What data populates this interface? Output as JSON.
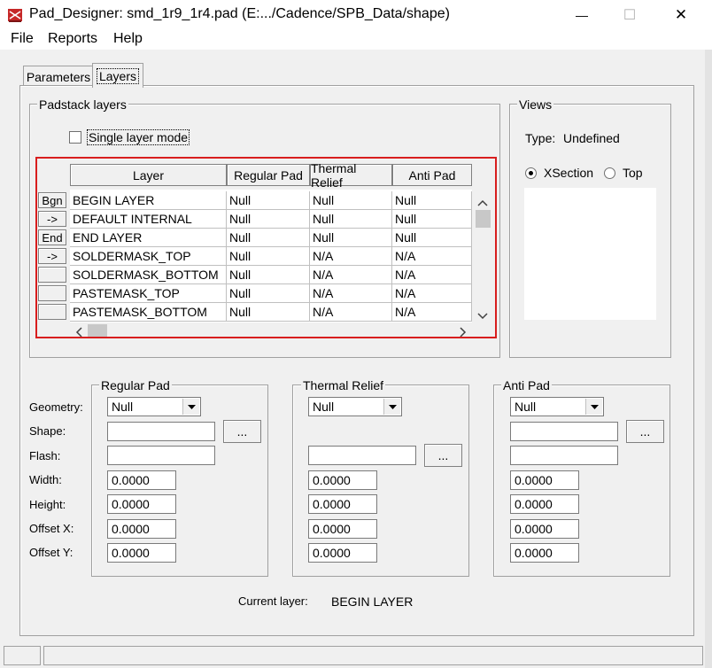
{
  "window": {
    "title": "Pad_Designer: smd_1r9_1r4.pad (E:.../Cadence/SPB_Data/shape)",
    "minimize_glyph": "—",
    "maximize_glyph": "☐",
    "close_glyph": "✕"
  },
  "menu": [
    "File",
    "Reports",
    "Help"
  ],
  "tabs": [
    {
      "label": "Parameters",
      "active": false
    },
    {
      "label": "Layers",
      "active": true
    }
  ],
  "padstack": {
    "group_label": "Padstack layers",
    "single_layer_mode_label": "Single layer mode",
    "single_layer_mode_checked": false,
    "highlight_color": "#d81e1e",
    "columns": [
      "Layer",
      "Regular Pad",
      "Thermal Relief",
      "Anti Pad"
    ],
    "rows": [
      {
        "btn": "Bgn",
        "layer": "BEGIN LAYER",
        "regular": "Null",
        "thermal": "Null",
        "anti": "Null"
      },
      {
        "btn": "->",
        "layer": "DEFAULT INTERNAL",
        "regular": "Null",
        "thermal": "Null",
        "anti": "Null"
      },
      {
        "btn": "End",
        "layer": "END LAYER",
        "regular": "Null",
        "thermal": "Null",
        "anti": "Null"
      },
      {
        "btn": "->",
        "layer": "SOLDERMASK_TOP",
        "regular": "Null",
        "thermal": "N/A",
        "anti": "N/A"
      },
      {
        "btn": "",
        "layer": "SOLDERMASK_BOTTOM",
        "regular": "Null",
        "thermal": "N/A",
        "anti": "N/A"
      },
      {
        "btn": "",
        "layer": "PASTEMASK_TOP",
        "regular": "Null",
        "thermal": "N/A",
        "anti": "N/A"
      },
      {
        "btn": "",
        "layer": "PASTEMASK_BOTTOM",
        "regular": "Null",
        "thermal": "N/A",
        "anti": "N/A"
      }
    ]
  },
  "views": {
    "group_label": "Views",
    "type_label": "Type:",
    "type_value": "Undefined",
    "xsection_label": "XSection",
    "top_label": "Top",
    "selected": "XSection"
  },
  "pad_params": {
    "field_labels": [
      "Geometry:",
      "Shape:",
      "Flash:",
      "Width:",
      "Height:",
      "Offset X:",
      "Offset Y:"
    ],
    "browse_label": "...",
    "groups": [
      {
        "label": "Regular Pad",
        "geometry": "Null",
        "width": "0.0000",
        "height": "0.0000",
        "offset_x": "0.0000",
        "offset_y": "0.0000"
      },
      {
        "label": "Thermal Relief",
        "geometry": "Null",
        "width": "0.0000",
        "height": "0.0000",
        "offset_x": "0.0000",
        "offset_y": "0.0000"
      },
      {
        "label": "Anti Pad",
        "geometry": "Null",
        "width": "0.0000",
        "height": "0.0000",
        "offset_x": "0.0000",
        "offset_y": "0.0000"
      }
    ]
  },
  "current_layer": {
    "label": "Current layer:",
    "value": "BEGIN LAYER"
  }
}
